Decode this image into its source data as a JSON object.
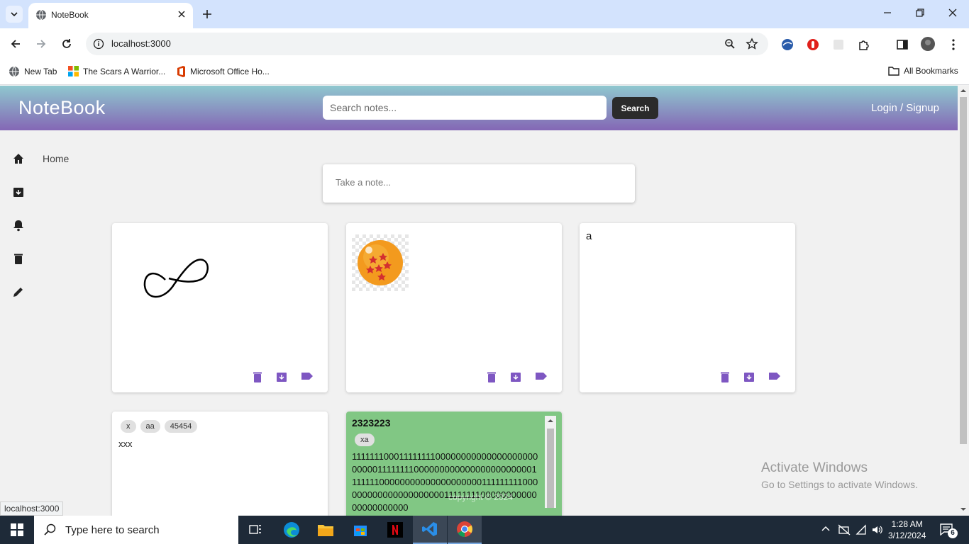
{
  "browser": {
    "tab_title": "NoteBook",
    "url": "localhost:3000",
    "bookmarks": [
      {
        "label": "New Tab",
        "icon": "globe-icon"
      },
      {
        "label": "The Scars A Warrior...",
        "icon": "microsoft-logo-icon"
      },
      {
        "label": "Microsoft Office Ho...",
        "icon": "office-icon"
      }
    ],
    "all_bookmarks": "All Bookmarks"
  },
  "app": {
    "brand": "NoteBook",
    "search_placeholder": "Search notes...",
    "search_button": "Search",
    "login": "Login / Signup",
    "sidebar": [
      {
        "icon": "home-icon",
        "label": "Home"
      },
      {
        "icon": "archive-icon"
      },
      {
        "icon": "bell-icon"
      },
      {
        "icon": "trash-icon"
      },
      {
        "icon": "pencil-icon"
      }
    ],
    "take_note_placeholder": "Take a note...",
    "notes": [
      {
        "type": "drawing",
        "content": "infinity sketch"
      },
      {
        "type": "image",
        "content": "dragon ball"
      },
      {
        "type": "text",
        "text": "a"
      },
      {
        "type": "labels",
        "labels": [
          "x",
          "aa",
          "45454"
        ],
        "text": "xxx"
      },
      {
        "type": "green",
        "color": "#81c784",
        "title": "2323223",
        "labels": [
          "xa"
        ],
        "body": "11111110001111111100000000000000000000000001111111100000000000000000000000111111100000000000000000000111111111000000000000000000000111111110000000000000000000000"
      }
    ],
    "copyright": "copyright © 2024",
    "status_url": "localhost:3000",
    "accent_color": "#7e57c2"
  },
  "windows": {
    "activate_title": "Activate Windows",
    "activate_sub": "Go to Settings to activate Windows.",
    "search_placeholder": "Type here to search",
    "time": "1:28 AM",
    "date": "3/12/2024",
    "notifications": "6"
  }
}
